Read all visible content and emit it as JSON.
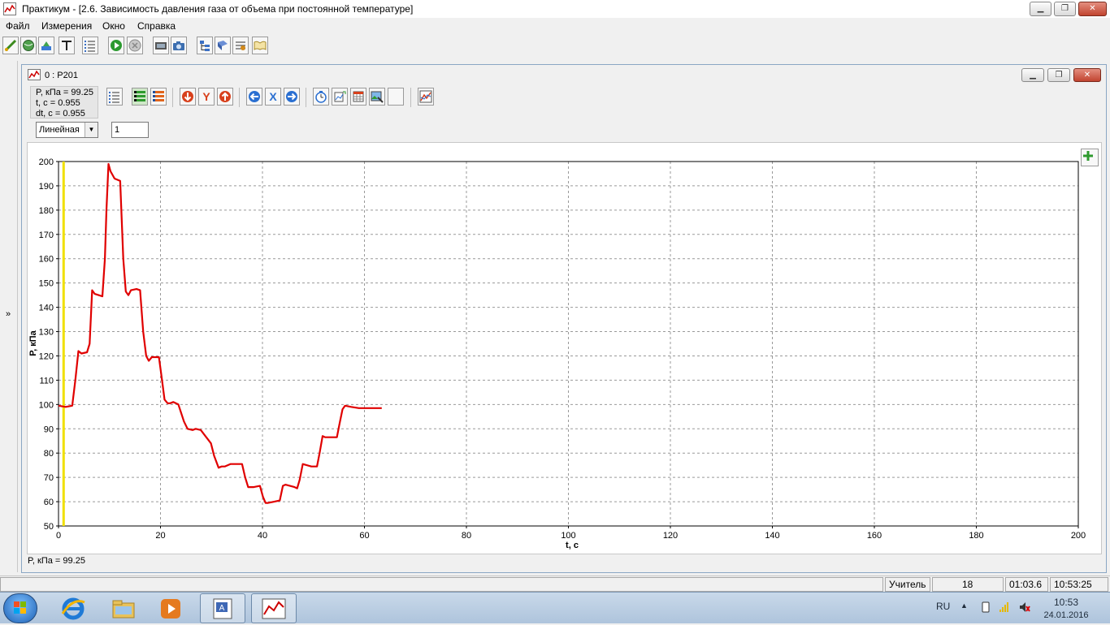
{
  "window": {
    "title": "Практикум - [2.6. Зависимость давления газа от объема при постоянной температуре]",
    "min_label": "▁",
    "max_label": "❐",
    "close_label": "✕"
  },
  "menu": [
    {
      "label": "Файл"
    },
    {
      "label": "Измерения"
    },
    {
      "label": "Окно"
    },
    {
      "label": "Справка"
    }
  ],
  "left_strip": {
    "toggle_label": "»"
  },
  "inner_window": {
    "title": "0 : P201",
    "min_label": "▁",
    "max_label": "❐",
    "close_label": "✕"
  },
  "readout": {
    "p": "P, кПа = 99.25",
    "t": "t, c = 0.955",
    "dt": "dt, c = 0.955"
  },
  "inner_toolbar": {
    "y_label": "Y",
    "x_label": "X"
  },
  "scale": {
    "selected": "Линейная",
    "arrow": "▼"
  },
  "value_field": {
    "value": "1"
  },
  "status_readout": "P, кПа = 99.25",
  "chart_data": {
    "type": "line",
    "xlabel": "t, c",
    "ylabel": "P, кПа",
    "xlim": [
      0,
      200
    ],
    "ylim": [
      50,
      200
    ],
    "xticks": [
      "0",
      "20",
      "40",
      "60",
      "80",
      "100",
      "120",
      "140",
      "160",
      "180",
      "200"
    ],
    "yticks": [
      "50",
      "60",
      "70",
      "80",
      "90",
      "100",
      "110",
      "120",
      "130",
      "140",
      "150",
      "160",
      "170",
      "180",
      "190",
      "200"
    ],
    "grid": true,
    "cursor_x": 1,
    "colors": {
      "series": "#e00000",
      "cursor": "#f0e000",
      "grid": "#999999"
    },
    "series": [
      {
        "x": [
          0,
          1.4,
          2.7,
          3.3,
          3.9,
          4.5,
          5.6,
          6.1,
          6.6,
          7.1,
          8.6,
          9.1,
          9.4,
          9.8,
          10.2,
          11,
          12.1,
          12.7,
          13.2,
          13.7,
          14.2,
          15.3,
          16,
          16.6,
          17.2,
          17.7,
          18.3,
          19.7,
          20.3,
          20.8,
          21.4,
          21.9,
          22.5,
          23.5,
          24.6,
          25.3,
          26.3,
          26.9,
          27.9,
          29.9,
          30.5,
          31.4,
          32,
          32.6,
          33.7,
          36,
          36.6,
          37.2,
          38.3,
          39.5,
          40.1,
          40.6,
          41.1,
          42.3,
          43.4,
          44,
          44.5,
          46.3,
          46.8,
          47.3,
          47.9,
          49.6,
          50.7,
          51.2,
          51.8,
          52.3,
          54.6,
          55.1,
          55.7,
          56.2,
          57.4,
          58.9,
          63.4
        ],
        "y": [
          99.5,
          99,
          99.5,
          110,
          122,
          121,
          121.5,
          125,
          147,
          145.5,
          144.5,
          160,
          180,
          199,
          196,
          193,
          192,
          160,
          146.5,
          145,
          147,
          147.5,
          147,
          130,
          120,
          118,
          119.5,
          119.5,
          110,
          102,
          100.5,
          100.5,
          101,
          100,
          93,
          90,
          89.5,
          90,
          89.5,
          84,
          79,
          74,
          74.5,
          74.5,
          75.5,
          75.5,
          70,
          66,
          66,
          66.5,
          62,
          59.5,
          59.5,
          60,
          60.5,
          66.5,
          67,
          66,
          65.5,
          69,
          75.5,
          74.5,
          74.5,
          80,
          87,
          86.5,
          86.5,
          92,
          98,
          99.5,
          99,
          98.5,
          98.5
        ]
      }
    ]
  },
  "status_bar": {
    "user_label": "Учитель",
    "count": "18",
    "elapsed": "01:03.6",
    "clock": "10:53:25"
  },
  "taskbar": {
    "lang": "RU",
    "tray_arrow": "▲",
    "time": "10:53",
    "date": "24.01.2016"
  }
}
